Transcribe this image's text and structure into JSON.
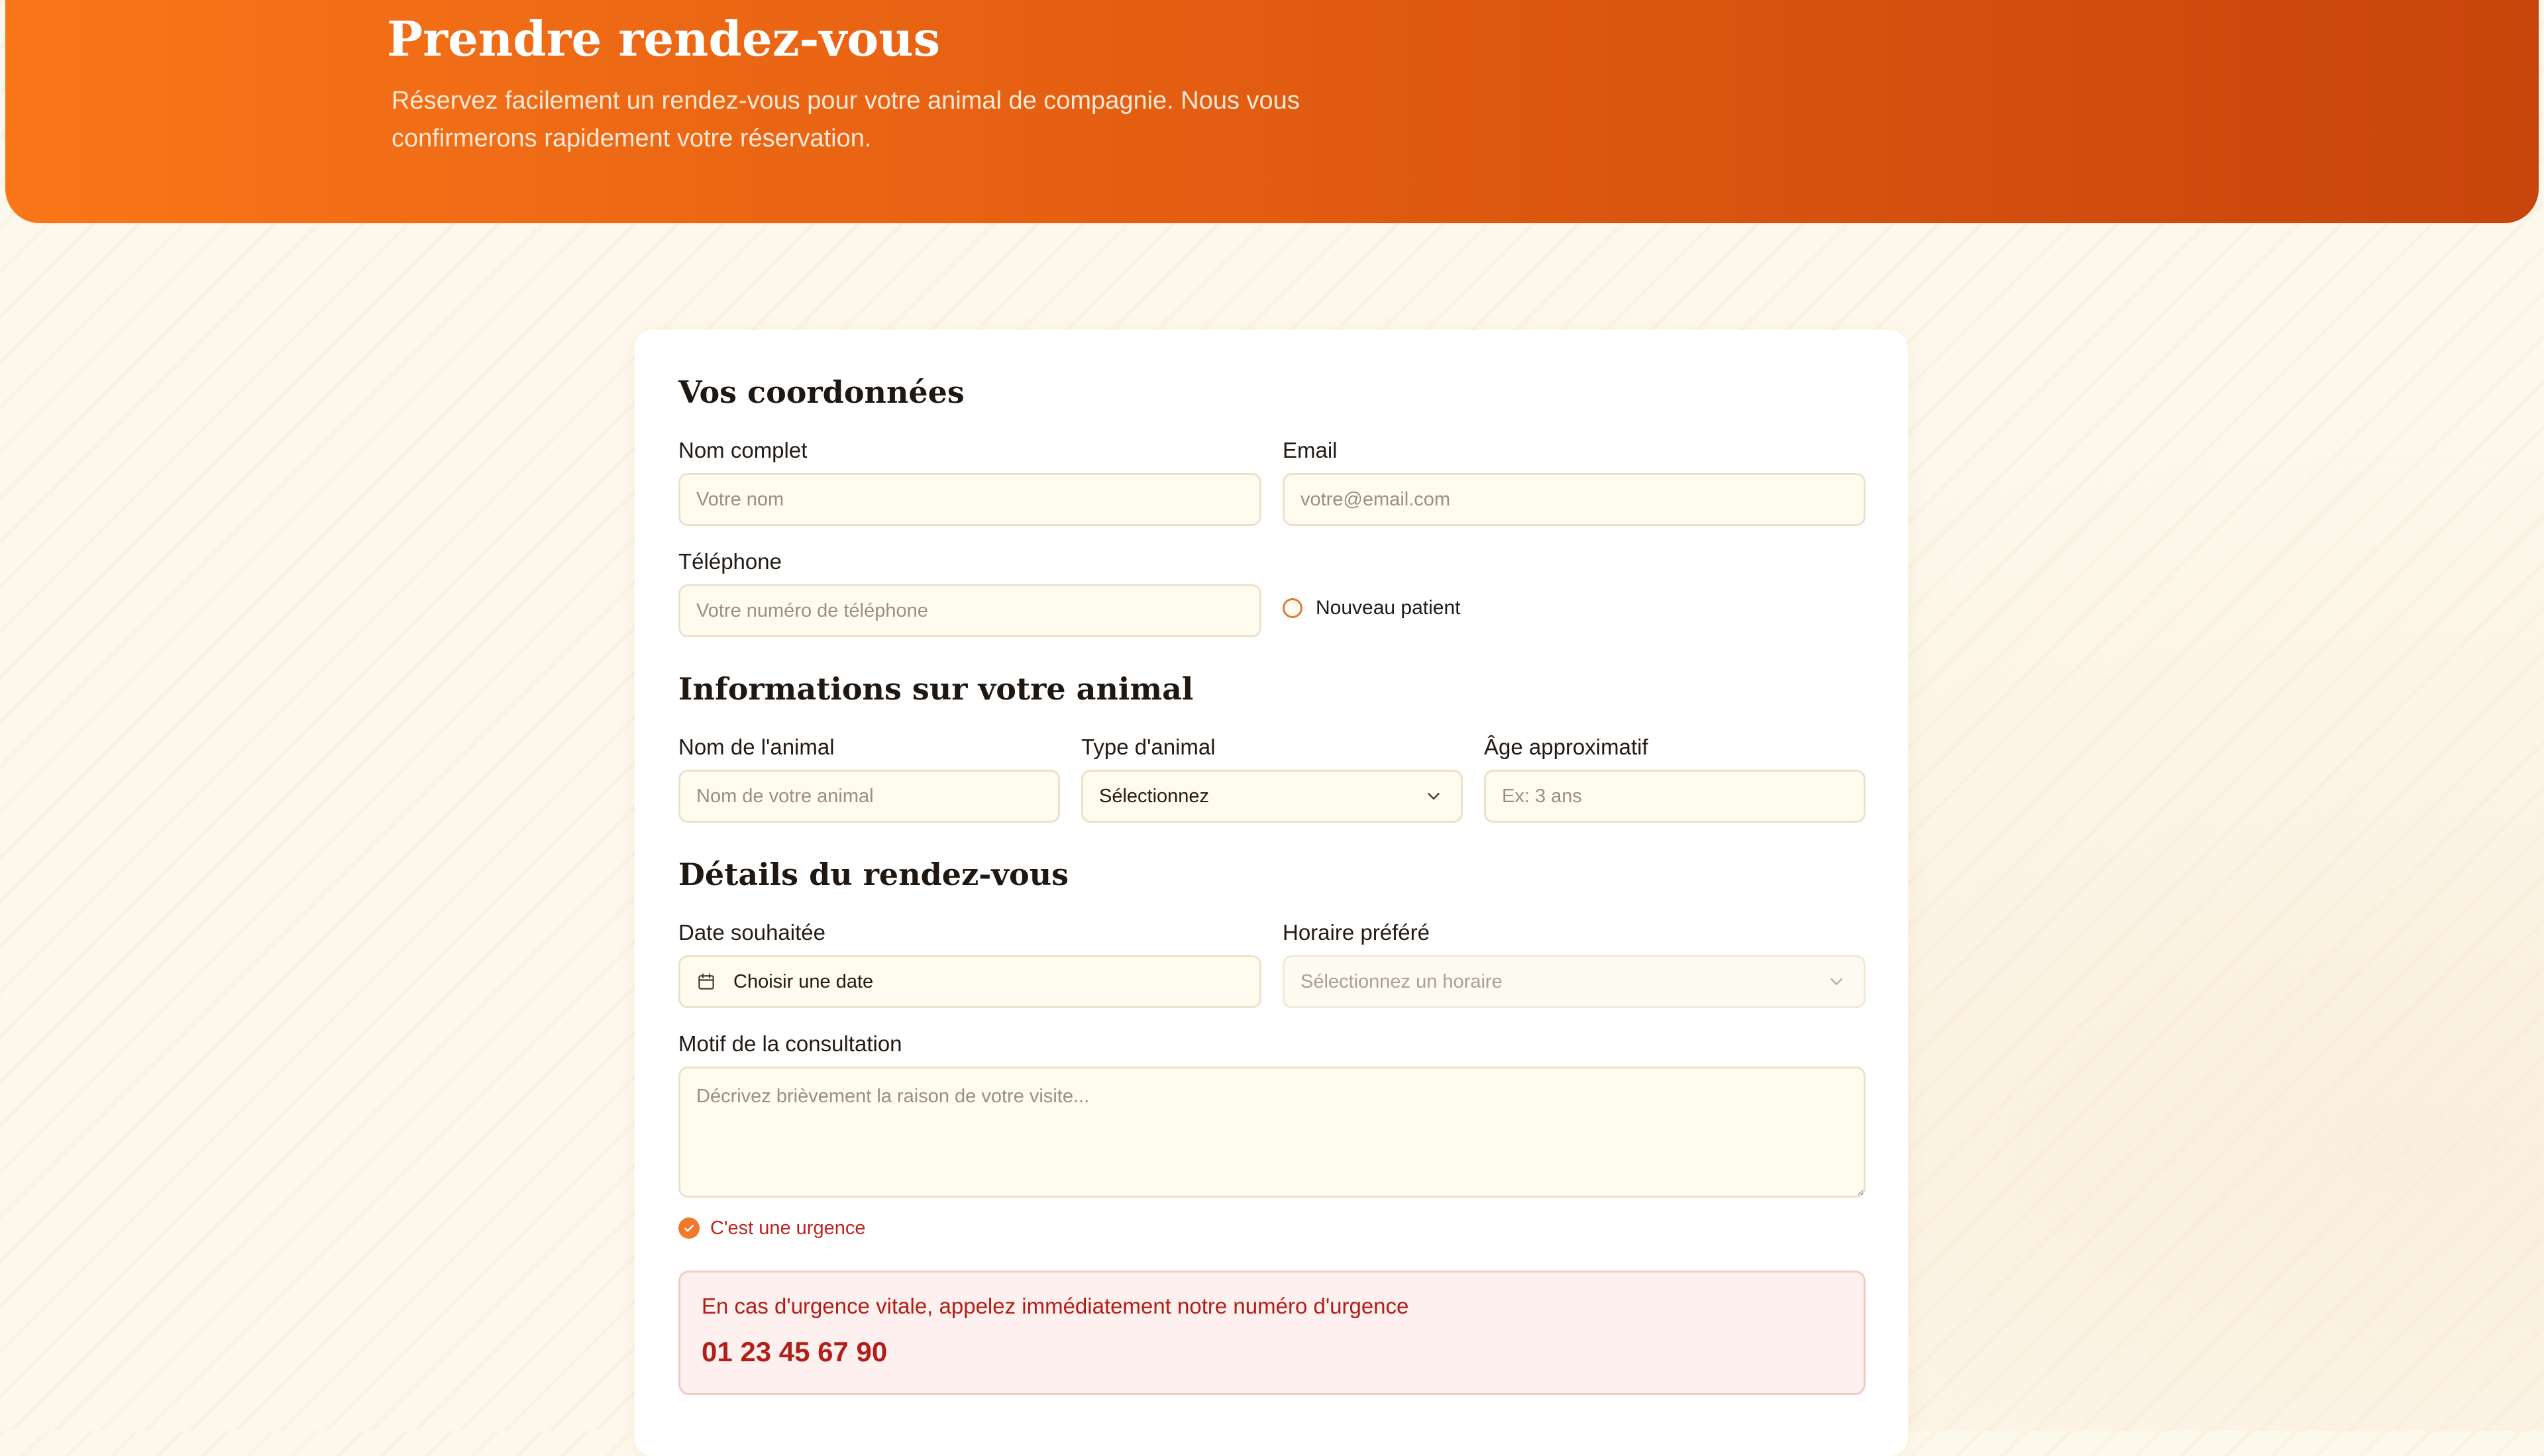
{
  "header": {
    "title": "Prendre rendez-vous",
    "subtitle": "Réservez facilement un rendez-vous pour votre animal de compagnie. Nous vous confirmerons rapidement votre réservation."
  },
  "contact": {
    "section_title": "Vos coordonnées",
    "name_label": "Nom complet",
    "name_placeholder": "Votre nom",
    "email_label": "Email",
    "email_placeholder": "votre@email.com",
    "phone_label": "Téléphone",
    "phone_placeholder": "Votre numéro de téléphone",
    "new_patient_label": "Nouveau patient",
    "new_patient_checked": false
  },
  "animal": {
    "section_title": "Informations sur votre animal",
    "name_label": "Nom de l'animal",
    "name_placeholder": "Nom de votre animal",
    "type_label": "Type d'animal",
    "type_value": "Sélectionnez",
    "age_label": "Âge approximatif",
    "age_placeholder": "Ex: 3 ans"
  },
  "appointment": {
    "section_title": "Détails du rendez-vous",
    "date_label": "Date souhaitée",
    "date_value": "Choisir une date",
    "time_label": "Horaire préféré",
    "time_placeholder": "Sélectionnez un horaire",
    "reason_label": "Motif de la consultation",
    "reason_placeholder": "Décrivez brièvement la raison de votre visite...",
    "urgent_label": "C'est une urgence",
    "urgent_checked": true
  },
  "emergency": {
    "message": "En cas d'urgence vitale, appelez immédiatement notre numéro d'urgence",
    "phone": "01 23 45 67 90"
  },
  "icons": {
    "calendar": "calendar-icon",
    "chevron": "chevron-down-icon",
    "check": "check-icon"
  },
  "colors": {
    "accent": "#f07a2a",
    "header_start": "#f97618",
    "header_end": "#c8450b",
    "danger": "#b11e18",
    "field_bg": "#fffbee"
  }
}
